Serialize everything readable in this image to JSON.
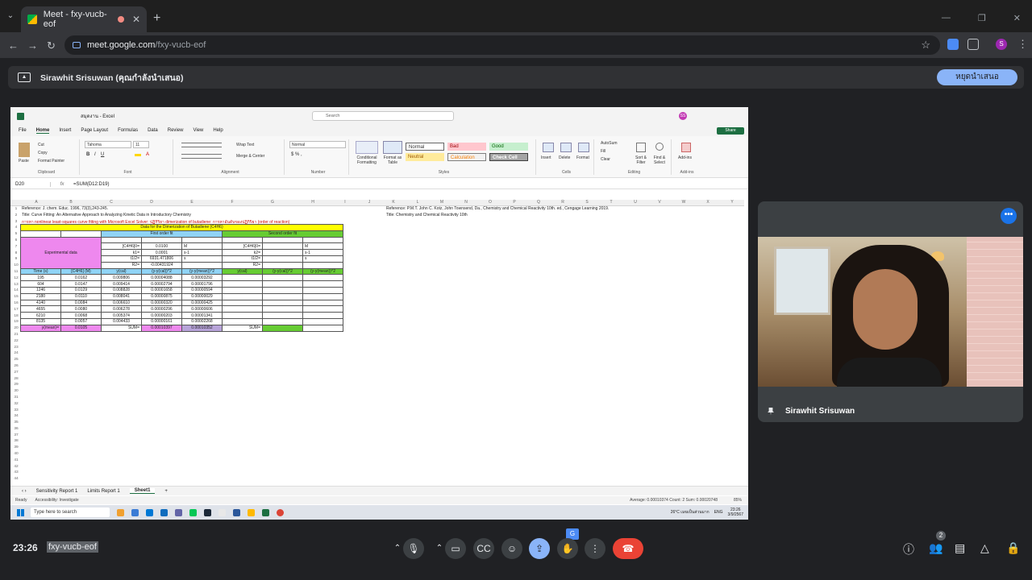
{
  "browser": {
    "tab_title": "Meet - fxy-vucb-eof",
    "url_host": "meet.google.com",
    "url_path": "/fxy-vucb-eof",
    "profile_initial": "S"
  },
  "banner": {
    "presenter_text": "Sirawhit Srisuwan (คุณกำลังนำเสนอ)",
    "stop_button": "หยุดนำเสนอ"
  },
  "excel": {
    "title": "สมุดงาน - Excel",
    "search_placeholder": "Search",
    "avatar": "SS",
    "menu": [
      "File",
      "Home",
      "Insert",
      "Page Layout",
      "Formulas",
      "Data",
      "Review",
      "View",
      "Help"
    ],
    "share": "Share",
    "font_name": "Tahoma",
    "font_size": "11",
    "number_format": "Normal",
    "styles": {
      "normal": "Normal",
      "bad": "Bad",
      "good": "Good",
      "neutral": "Neutral",
      "calculation": "Calculation",
      "check_cell": "Check Cell"
    },
    "ribbon": {
      "clipboard": "Clipboard",
      "paste": "Paste",
      "cut": "Cut",
      "copy": "Copy",
      "format_painter": "Format Painter",
      "font": "Font",
      "alignment": "Alignment",
      "wrap_text": "Wrap Text",
      "merge_center": "Merge & Center",
      "number": "Number",
      "styles": "Styles",
      "conditional_formatting": "Conditional Formatting",
      "format_as_table": "Format as Table",
      "cells": "Cells",
      "insert": "Insert",
      "delete": "Delete",
      "format": "Format",
      "editing": "Editing",
      "autosum": "AutoSum",
      "fill": "Fill",
      "clear": "Clear",
      "sort_filter": "Sort & Filter",
      "find_select": "Find & Select",
      "addins": "Add-ins",
      "addins_label": "Add-ins"
    },
    "name_box": "D20",
    "formula": "=SUM(D12:D19)",
    "columns": [
      "A",
      "B",
      "C",
      "D",
      "E",
      "F",
      "G",
      "H",
      "I",
      "J",
      "K",
      "L",
      "M",
      "N",
      "O",
      "P",
      "Q",
      "R",
      "S",
      "T",
      "U",
      "V",
      "W",
      "X",
      "Y"
    ],
    "ref1": "Reference: J. chem. Educ. 1996, 73(3),243-245.",
    "ref2": "Title: Curve Fitting: An Alternative Approach to Analyzing Kinetic Data in Introductory Chemistry",
    "ref3": "การหา nonlinear least-squares curve fitting with Microsoft Excel Solver: ปฏิกิริยา dimerization of butadiene: การหาอันดับของปฏิกิริยา (order of reaction)",
    "ref_right1": "Reference: P.M.T. John C. Kotz, John Townsend, Da., Chemistry and Chemical Reactivity 10th. ed., Cengage Learning 2019.",
    "ref_right2": "Title: Chemistry and Chemical Reactivity 10th",
    "table_title": "Data for the Dimerization of Butadiene (C4H6)",
    "first_order": "First order fit",
    "second_order": "Second order fit",
    "experimental": "Experimental data",
    "params": [
      {
        "label": "[C4H6]0=",
        "value": "0.0100",
        "unit": "M",
        "label2": "[C4H6]0=",
        "unit2": "M"
      },
      {
        "label": "k1=",
        "value": "0.0001",
        "unit": "s-1",
        "label2": "k2=",
        "unit2": "s-1"
      },
      {
        "label": "t1/2=",
        "value": "6931.471806",
        "unit": "s",
        "label2": "t1/2=",
        "unit2": "s"
      },
      {
        "label": "R2=",
        "value": "-0.00431924",
        "unit": "",
        "label2": "R2=",
        "unit2": ""
      }
    ],
    "headers": [
      "Time (s)",
      "[C4H6] (M)",
      "y(cal)",
      "(y-y(cal))^2",
      "(y-y(mean))^2",
      "y(cal)",
      "(y-y(cal))^2",
      "(y-y(mean))^2"
    ],
    "rows": [
      [
        "195",
        "0.0162",
        "0.009806",
        "0.00004088",
        "0.00003292"
      ],
      [
        "604",
        "0.0147",
        "0.009414",
        "0.00002794",
        "0.00001796"
      ],
      [
        "1246",
        "0.0129",
        "0.008828",
        "0.00001658",
        "0.00000594"
      ],
      [
        "2180",
        "0.0110",
        "0.008041",
        "0.00000875",
        "0.00000029"
      ],
      [
        "4140",
        "0.0084",
        "0.006610",
        "0.00000320",
        "0.00000425"
      ],
      [
        "4655",
        "0.0080",
        "0.006278",
        "0.00000296",
        "0.00000606"
      ],
      [
        "6210",
        "0.0068",
        "0.005374",
        "0.00000203",
        "0.00001341"
      ],
      [
        "8135",
        "0.0057",
        "0.004433",
        "0.00000161",
        "0.00002268"
      ]
    ],
    "mean_label": "y(mean)=",
    "mean_value": "0.0105",
    "sum_label": "SUM=",
    "sum1": "0.00010397",
    "sum2": "0.00010352",
    "sheets": [
      "Sensitivity Report 1",
      "Limits Report 1",
      "Sheet1"
    ],
    "status_ready": "Ready",
    "status_accessibility": "Accessibility: Investigate",
    "status_stats": "Average: 0.00010374    Count: 2    Sum: 0.00020748",
    "zoom": "85%"
  },
  "taskbar": {
    "search": "Type here to search",
    "weather": "26°C  เมฆเป็นส่วนมาก",
    "lang": "ENG",
    "time": "23:26",
    "date": "3/9/2567"
  },
  "participant": {
    "name": "Sirawhit Srisuwan"
  },
  "meet": {
    "time": "23:26",
    "code": "fxy-vucb-eof",
    "people_count": "2"
  }
}
